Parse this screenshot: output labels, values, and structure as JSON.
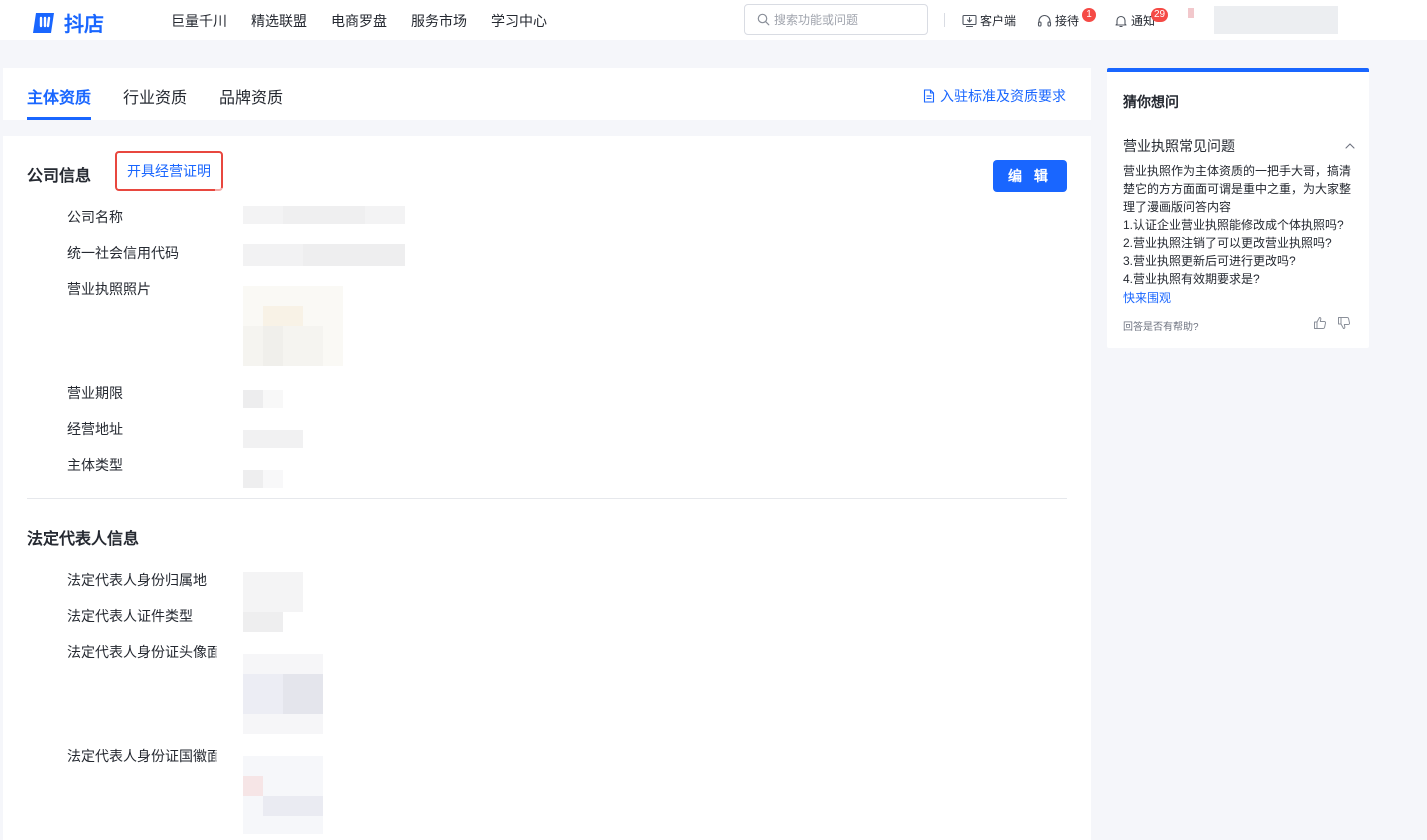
{
  "header": {
    "logo_text": "抖店",
    "nav": [
      "巨量千川",
      "精选联盟",
      "电商罗盘",
      "服务市场",
      "学习中心"
    ],
    "search_placeholder": "搜索功能或问题",
    "client_label": "客户端",
    "reception_label": "接待",
    "reception_badge": "1",
    "notify_label": "通知",
    "notify_badge": "29"
  },
  "tabs": {
    "items": [
      "主体资质",
      "行业资质",
      "品牌资质"
    ],
    "active": "主体资质",
    "standards_link": "入驻标准及资质要求"
  },
  "company": {
    "title": "公司信息",
    "cert_button": "开具经营证明",
    "edit_button": "编 辑",
    "fields": [
      "公司名称",
      "统一社会信用代码",
      "营业执照照片",
      "营业期限",
      "经营地址",
      "主体类型"
    ]
  },
  "legal": {
    "title": "法定代表人信息",
    "fields": [
      "法定代表人身份归属地",
      "法定代表人证件类型",
      "法定代表人身份证头像面",
      "法定代表人身份证国徽面"
    ]
  },
  "side": {
    "title": "猜你想问",
    "faq_title": "营业执照常见问题",
    "faq_intro": "营业执照作为主体资质的一把手大哥，搞清楚它的方方面面可谓是重中之重，为大家整理了漫画版问答内容",
    "faq_items": [
      "1.认证企业营业执照能修改成个体执照吗?",
      "2.营业执照注销了可以更改营业执照吗?",
      "3.营业执照更新后可进行更改吗?",
      "4.营业执照有效期要求是?"
    ],
    "more_link": "快来围观",
    "helpful_text": "回答是否有帮助?"
  },
  "colors": {
    "accent": "#1966ff",
    "highlight_border": "#e8473f",
    "badge": "#f54a45"
  }
}
